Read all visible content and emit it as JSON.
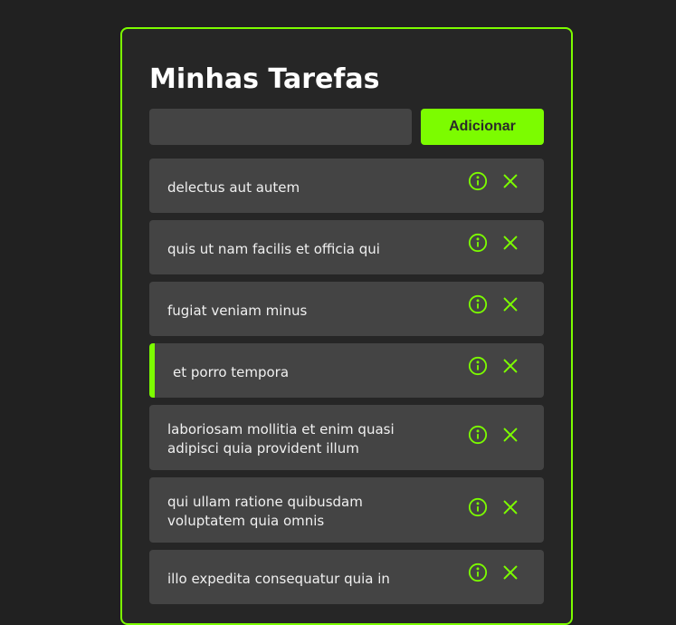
{
  "header": {
    "title": "Minhas Tarefas"
  },
  "add_form": {
    "input_value": "",
    "input_placeholder": "",
    "button_label": "Adicionar"
  },
  "colors": {
    "accent": "#7cfc00",
    "background": "#212121",
    "card": "#262626",
    "item": "#444444"
  },
  "tasks": [
    {
      "title": "delectus aut autem",
      "active": false
    },
    {
      "title": "quis ut nam facilis et officia qui",
      "active": false
    },
    {
      "title": "fugiat veniam minus",
      "active": false
    },
    {
      "title": "et porro tempora",
      "active": true
    },
    {
      "title": "laboriosam mollitia et enim quasi adipisci quia provident illum",
      "active": false
    },
    {
      "title": "qui ullam ratione quibusdam voluptatem quia omnis",
      "active": false
    },
    {
      "title": "illo expedita consequatur quia in",
      "active": false
    }
  ],
  "icons": {
    "details": "info-icon",
    "remove": "close-icon"
  }
}
